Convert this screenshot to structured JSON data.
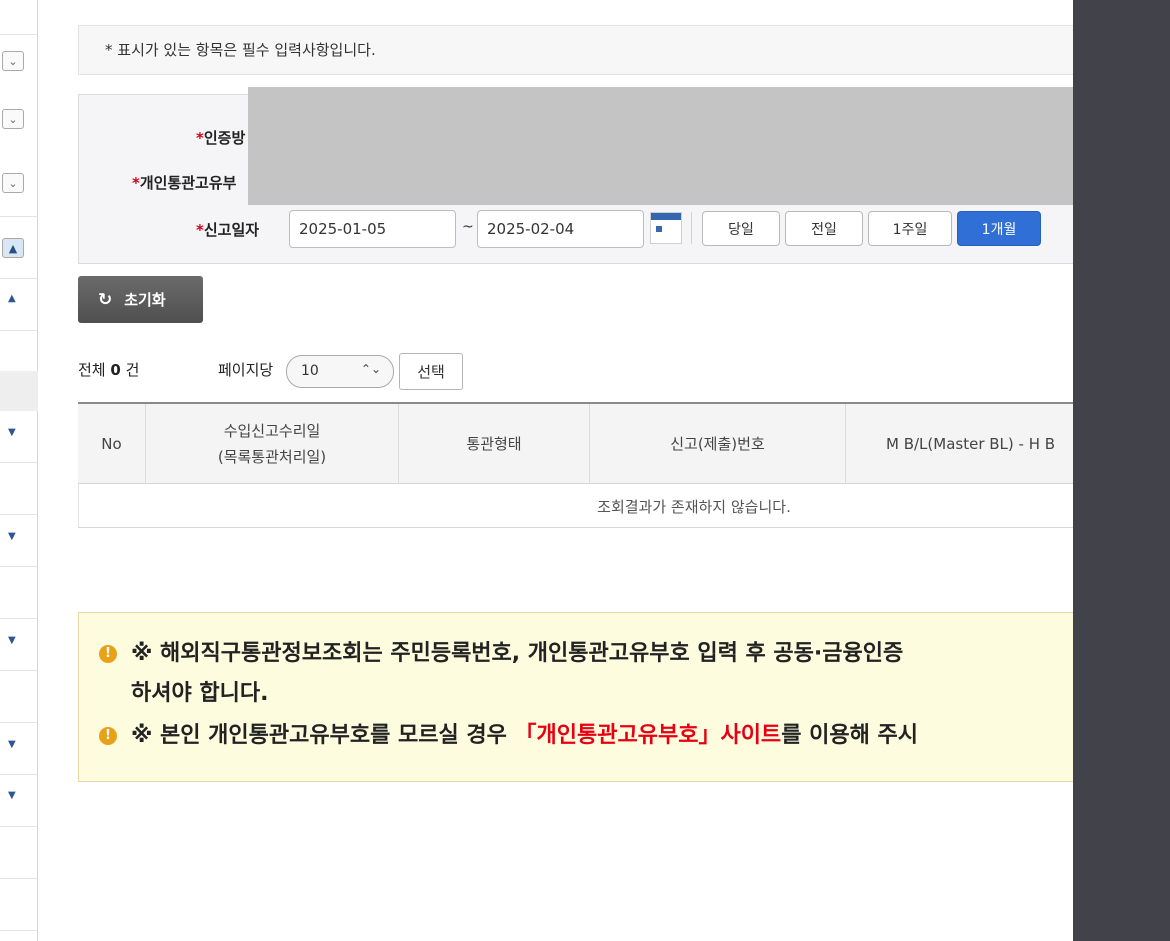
{
  "notice": "* 표시가 있는 항목은 필수 입력사항입니다.",
  "form": {
    "cert_label_required": "*",
    "cert_label": "인증방",
    "customs_code_label_required": "*",
    "customs_code_label": "개인통관고유부",
    "report_date_label_required": "*",
    "report_date_label": "신고일자",
    "date_from": "2025-01-05",
    "tilde": "~",
    "date_to": "2025-02-04",
    "period_buttons": [
      "당일",
      "전일",
      "1주일",
      "1개월"
    ],
    "active_period": "1개월"
  },
  "reset_label": "초기화",
  "results": {
    "total_prefix": "전체",
    "total_count": "0",
    "total_suffix": "건",
    "per_page_label": "페이지당",
    "per_page_value": "10",
    "select_button": "선택"
  },
  "table": {
    "headers": [
      "No",
      "수입신고수리일",
      "(목록통관처리일)",
      "통관형태",
      "신고(제출)번호",
      "M B/L(Master BL) - H B"
    ],
    "empty_message": "조회결과가 존재하지 않습니다."
  },
  "warning": {
    "line1": "※ 해외직구통관정보조회는 주민등록번호, 개인통관고유부호 입력 후 공동·금융인증",
    "line1b": "하셔야 합니다.",
    "line2_prefix": "※ 본인 개인통관고유부호를 모르실 경우 ",
    "line2_link": "「개인통관고유부호」사이트",
    "line2_suffix": "를 이용해 주시"
  },
  "colors": {
    "accent_blue": "#2f6fd6",
    "warning_bg": "#fefcde",
    "warning_icon": "#e8a21a",
    "required_red": "#d0021b",
    "link_red": "#e60012",
    "dark_panel": "#42424b"
  },
  "icons": {
    "calendar": "calendar-icon",
    "reset": "refresh-icon",
    "warning": "exclamation-circle-icon",
    "select_arrows": "updown-chevron-icon"
  }
}
